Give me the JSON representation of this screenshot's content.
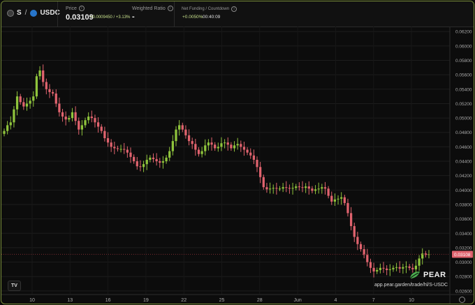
{
  "header": {
    "pair_base": "S",
    "pair_sep": "/",
    "pair_quote": "USDC",
    "price_label": "Price",
    "price_value": "0.03109",
    "price_change": "+0.0009450 / +3.13%",
    "weighted_label": "Weighted Ratio",
    "weighted_value": "-",
    "funding_label": "Net Funding / Countdown",
    "funding_value": "+0.0050%",
    "countdown_value": "00:40:09"
  },
  "colors": {
    "up": "#8fc43c",
    "down": "#e0636e",
    "accent": "#c7e08c",
    "price_tag": "#e0636e"
  },
  "icons": {
    "base": "s-coin-icon",
    "quote": "usdc-coin-icon",
    "info": "info-icon",
    "logo": "tradingview-logo-icon",
    "brand": "pear-leaf-icon",
    "settings": "gear-icon"
  },
  "brand": {
    "name": "PEAR",
    "url": "app.pear.garden/trade/hl/S-USDC"
  },
  "tv_logo_text": "TV",
  "chart_data": {
    "type": "candlestick",
    "x_tick_labels": [
      "10",
      "13",
      "16",
      "19",
      "22",
      "25",
      "28",
      "Jun",
      "4",
      "7",
      "10"
    ],
    "y_tick_labels": [
      "0.06200",
      "0.06000",
      "0.05800",
      "0.05600",
      "0.05400",
      "0.05200",
      "0.05000",
      "0.04800",
      "0.04600",
      "0.04400",
      "0.04200",
      "0.04000",
      "0.03800",
      "0.03600",
      "0.03400",
      "0.03200",
      "0.03000",
      "0.02800",
      "0.02600"
    ],
    "ylim": [
      0.0255,
      0.0627
    ],
    "current_price_label": "0.03108",
    "current_price": 0.03108,
    "grid": true,
    "close_series": [
      0.0482,
      0.049,
      0.0494,
      0.0512,
      0.053,
      0.0522,
      0.0516,
      0.052,
      0.0524,
      0.053,
      0.0558,
      0.0566,
      0.055,
      0.054,
      0.0536,
      0.0534,
      0.052,
      0.0508,
      0.0502,
      0.0498,
      0.05,
      0.0508,
      0.0496,
      0.0484,
      0.049,
      0.0497,
      0.0502,
      0.05,
      0.0494,
      0.0488,
      0.0482,
      0.0472,
      0.0466,
      0.046,
      0.0458,
      0.0457,
      0.0457,
      0.0456,
      0.0452,
      0.0446,
      0.044,
      0.0433,
      0.0432,
      0.0436,
      0.0442,
      0.0445,
      0.0443,
      0.044,
      0.0438,
      0.044,
      0.0445,
      0.0454,
      0.0468,
      0.0484,
      0.049,
      0.0484,
      0.0476,
      0.0468,
      0.0464,
      0.0456,
      0.045,
      0.0454,
      0.0462,
      0.0466,
      0.0463,
      0.0458,
      0.046,
      0.0465,
      0.0466,
      0.0463,
      0.0458,
      0.0462,
      0.0464,
      0.046,
      0.0456,
      0.0452,
      0.0448,
      0.0442,
      0.0432,
      0.0418,
      0.0404,
      0.0401,
      0.0402,
      0.0403,
      0.0402,
      0.0402,
      0.0404,
      0.0403,
      0.0402,
      0.0403,
      0.0405,
      0.0404,
      0.0403,
      0.0405,
      0.0402,
      0.0399,
      0.0401,
      0.0402,
      0.0404,
      0.0402,
      0.0392,
      0.0384,
      0.0387,
      0.0388,
      0.039,
      0.0382,
      0.0368,
      0.035,
      0.0335,
      0.0325,
      0.0318,
      0.031,
      0.03,
      0.0292,
      0.0287,
      0.0289,
      0.0292,
      0.0291,
      0.0289,
      0.029,
      0.0292,
      0.0293,
      0.0291,
      0.0293,
      0.0294,
      0.0292,
      0.029,
      0.0295,
      0.0305,
      0.0312,
      0.031,
      0.0311
    ]
  }
}
